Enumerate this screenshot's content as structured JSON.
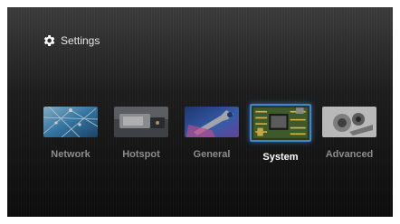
{
  "header": {
    "title": "Settings",
    "icon": "gear-icon"
  },
  "accent_color": "#3e86cf",
  "tiles": [
    {
      "label": "Network",
      "icon": "network-thumbnail",
      "selected": false
    },
    {
      "label": "Hotspot",
      "icon": "hotspot-thumbnail",
      "selected": false
    },
    {
      "label": "General",
      "icon": "general-thumbnail",
      "selected": false
    },
    {
      "label": "System",
      "icon": "system-thumbnail",
      "selected": true
    },
    {
      "label": "Advanced",
      "icon": "advanced-thumbnail",
      "selected": false
    }
  ]
}
